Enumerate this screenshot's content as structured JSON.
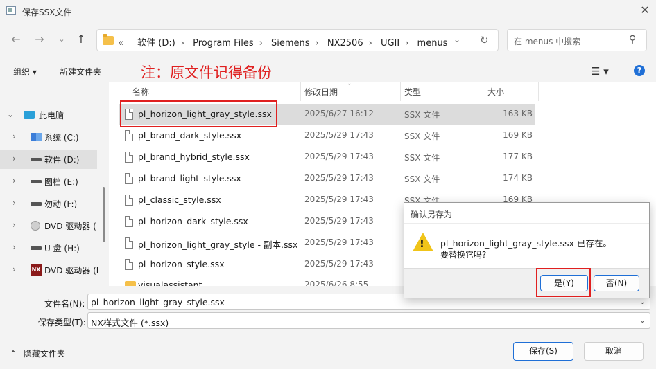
{
  "window": {
    "title": "保存SSX文件"
  },
  "address": {
    "crumbs": [
      "«",
      "软件 (D:)",
      "Program Files",
      "Siemens",
      "NX2506",
      "UGII",
      "menus"
    ]
  },
  "search": {
    "placeholder": "在 menus 中搜索"
  },
  "toolbar": {
    "organize": "组织 ▾",
    "new_folder": "新建文件夹"
  },
  "annotation": {
    "note": "注：原文件记得备份"
  },
  "nav": {
    "items": [
      {
        "label": "此电脑",
        "icon": "monitor-icon"
      },
      {
        "label": "系统 (C:)",
        "icon": "windows-drive-icon"
      },
      {
        "label": "软件 (D:)",
        "icon": "drive-icon"
      },
      {
        "label": "图档 (E:)",
        "icon": "drive-icon"
      },
      {
        "label": "勿动 (F:)",
        "icon": "drive-icon"
      },
      {
        "label": "DVD 驱动器 (",
        "icon": "dvd-icon"
      },
      {
        "label": "U 盘 (H:)",
        "icon": "usb-drive-icon"
      },
      {
        "label": "DVD 驱动器 (I",
        "icon": "nx-dvd-icon"
      }
    ]
  },
  "columns": {
    "name": "名称",
    "date": "修改日期",
    "type": "类型",
    "size": "大小"
  },
  "files": [
    {
      "name": "pl_horizon_light_gray_style.ssx",
      "date": "2025/6/27 16:12",
      "type": "SSX 文件",
      "size": "163 KB"
    },
    {
      "name": "pl_brand_dark_style.ssx",
      "date": "2025/5/29 17:43",
      "type": "SSX 文件",
      "size": "169 KB"
    },
    {
      "name": "pl_brand_hybrid_style.ssx",
      "date": "2025/5/29 17:43",
      "type": "SSX 文件",
      "size": "177 KB"
    },
    {
      "name": "pl_brand_light_style.ssx",
      "date": "2025/5/29 17:43",
      "type": "SSX 文件",
      "size": "174 KB"
    },
    {
      "name": "pl_classic_style.ssx",
      "date": "2025/5/29 17:43",
      "type": "SSX 文件",
      "size": "169 KB"
    },
    {
      "name": "pl_horizon_dark_style.ssx",
      "date": "2025/5/29 17:43",
      "type": "",
      "size": ""
    },
    {
      "name": "pl_horizon_light_gray_style - 副本.ssx",
      "date": "2025/5/29 17:43",
      "type": "",
      "size": ""
    },
    {
      "name": "pl_horizon_style.ssx",
      "date": "2025/5/29 17:43",
      "type": "",
      "size": ""
    }
  ],
  "partial_folder": {
    "name": "visualassistant",
    "date": "2025/6/26 8:55"
  },
  "form": {
    "filename_label": "文件名(N):",
    "filename_value": "pl_horizon_light_gray_style.ssx",
    "filetype_label": "保存类型(T):",
    "filetype_value": "NX样式文件 (*.ssx)"
  },
  "buttons": {
    "save": "保存(S)",
    "cancel": "取消",
    "hide_folders": "隐藏文件夹"
  },
  "dialog": {
    "title": "确认另存为",
    "message1": "pl_horizon_light_gray_style.ssx 已存在。",
    "message2": "要替换它吗?",
    "yes": "是(Y)",
    "no": "否(N)"
  }
}
